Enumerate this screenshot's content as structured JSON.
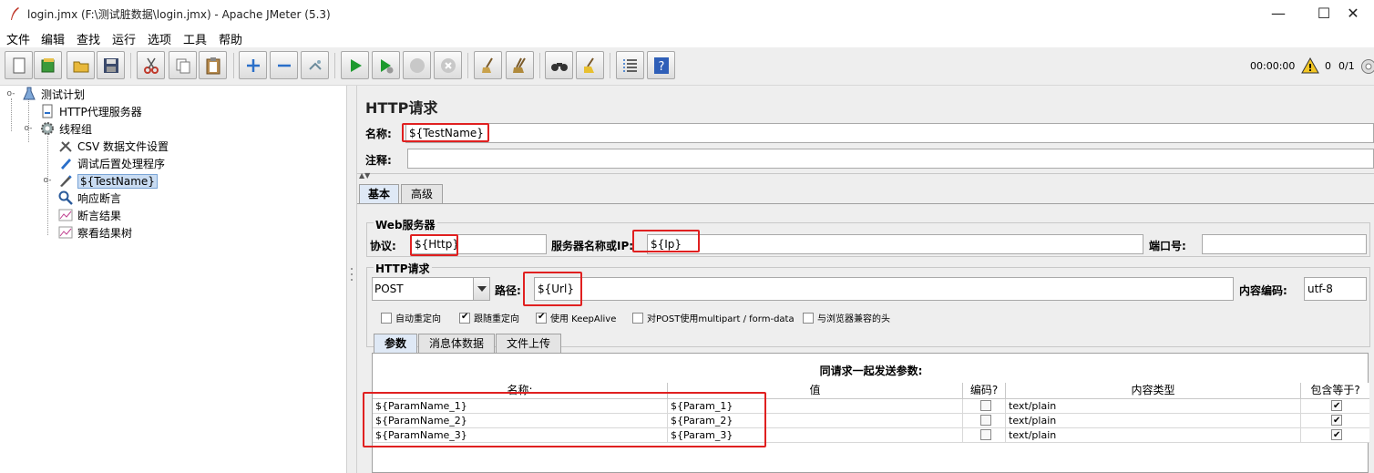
{
  "window": {
    "title": "login.jmx (F:\\测试脏数据\\login.jmx) - Apache JMeter (5.3)",
    "minimize": "—",
    "maximize": "☐",
    "close": "✕"
  },
  "menus": [
    "文件",
    "编辑",
    "查找",
    "运行",
    "选项",
    "工具",
    "帮助"
  ],
  "status": {
    "timer": "00:00:00",
    "errors": "0",
    "threads": "0/1"
  },
  "tree": {
    "nodes": [
      {
        "label": "测试计划",
        "icon": "test-plan-icon"
      },
      {
        "label": "HTTP代理服务器",
        "icon": "proxy-icon"
      },
      {
        "label": "线程组",
        "icon": "thread-group-icon"
      },
      {
        "label": "CSV 数据文件设置",
        "icon": "config-icon"
      },
      {
        "label": "调试后置处理程序",
        "icon": "postprocessor-icon"
      },
      {
        "label": "${TestName}",
        "icon": "sampler-icon"
      },
      {
        "label": "响应断言",
        "icon": "assertion-icon"
      },
      {
        "label": "断言结果",
        "icon": "listener-icon"
      },
      {
        "label": "察看结果树",
        "icon": "listener-icon"
      }
    ]
  },
  "panel": {
    "title": "HTTP请求",
    "name_label": "名称:",
    "name_value": "${TestName}",
    "comment_label": "注释:",
    "comment_value": "",
    "tabs": [
      "基本",
      "高级"
    ],
    "web_server_title": "Web服务器",
    "protocol_label": "协议:",
    "protocol_value": "${Http}",
    "server_label": "服务器名称或IP:",
    "server_value": "${Ip}",
    "port_label": "端口号:",
    "port_value": "",
    "http_request_title": "HTTP请求",
    "method_value": "POST",
    "path_label": "路径:",
    "path_value": "${Url}",
    "encoding_label": "内容编码:",
    "encoding_value": "utf-8",
    "options": [
      {
        "label": "自动重定向",
        "checked": false
      },
      {
        "label": "跟随重定向",
        "checked": true
      },
      {
        "label": "使用 KeepAlive",
        "checked": true
      },
      {
        "label": "对POST使用multipart / form-data",
        "checked": false
      },
      {
        "label": "与浏览器兼容的头",
        "checked": false
      }
    ],
    "sub_tabs": [
      "参数",
      "消息体数据",
      "文件上传"
    ],
    "table_caption": "同请求一起发送参数:",
    "columns": [
      "名称:",
      "值",
      "编码?",
      "内容类型",
      "包含等于?"
    ],
    "rows": [
      {
        "name": "${ParamName_1}",
        "value": "${Param_1}",
        "encode": false,
        "content_type": "text/plain",
        "include_equals": true
      },
      {
        "name": "${ParamName_2}",
        "value": "${Param_2}",
        "encode": false,
        "content_type": "text/plain",
        "include_equals": true
      },
      {
        "name": "${ParamName_3}",
        "value": "${Param_3}",
        "encode": false,
        "content_type": "text/plain",
        "include_equals": true
      }
    ]
  }
}
